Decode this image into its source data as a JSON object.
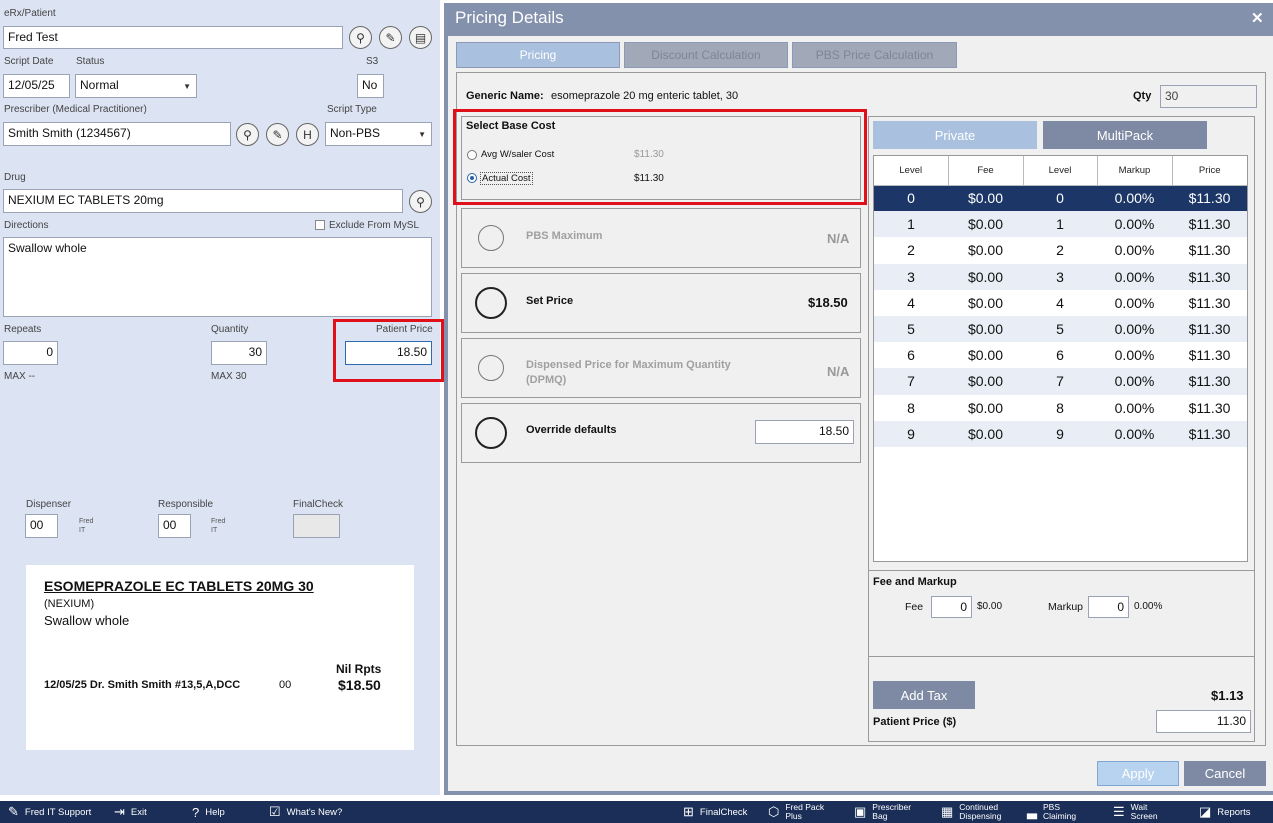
{
  "left": {
    "erx_label": "eRx/Patient",
    "patient_value": "Fred Test",
    "script_date_label": "Script Date",
    "script_date_value": "12/05/25",
    "status_label": "Status",
    "status_value": "Normal",
    "s3_label": "S3",
    "s3_value": "No",
    "prescriber_label": "Prescriber (Medical Practitioner)",
    "prescriber_value": "Smith Smith (1234567)",
    "h_button": "H",
    "script_type_label": "Script Type",
    "script_type_value": "Non-PBS",
    "drug_label": "Drug",
    "drug_value": "NEXIUM EC TABLETS 20mg",
    "directions_label": "Directions",
    "exclude_label": "Exclude From MySL",
    "directions_value": "Swallow whole",
    "repeats_label": "Repeats",
    "repeats_value": "0",
    "repeats_max": "MAX --",
    "quantity_label": "Quantity",
    "quantity_value": "30",
    "quantity_max": "MAX 30",
    "patient_price_label": "Patient Price",
    "patient_price_value": "18.50",
    "dispenser_label": "Dispenser",
    "dispenser_value": "00",
    "dispenser_name": "Fred",
    "dispenser_name2": "IT",
    "responsible_label": "Responsible",
    "responsible_value": "00",
    "responsible_name": "Fred",
    "responsible_name2": "IT",
    "finalcheck_label": "FinalCheck"
  },
  "label_preview": {
    "title": "ESOMEPRAZOLE EC TABLETS 20MG 30",
    "brand": "(NEXIUM)",
    "directions": "Swallow whole",
    "repeats": "Nil Rpts",
    "footer_left": "12/05/25 Dr.  Smith Smith #13,5,A,DCC",
    "footer_code": "00",
    "price": "$18.50"
  },
  "dialog": {
    "title": "Pricing Details",
    "close": "✕",
    "tabs": [
      "Pricing",
      "Discount Calculation",
      "PBS Price Calculation"
    ],
    "generic_label": "Generic Name:",
    "generic_value": "esomeprazole 20 mg enteric tablet, 30",
    "qty_label": "Qty",
    "qty_value": "30",
    "base_cost_title": "Select Base Cost",
    "avg_label": "Avg W/saler Cost",
    "avg_value": "$11.30",
    "actual_label": "Actual Cost",
    "actual_value": "$11.30",
    "options": [
      {
        "label": "PBS Maximum",
        "value": "N/A"
      },
      {
        "label": "Set Price",
        "value": "$18.50"
      },
      {
        "label": "Dispensed Price for Maximum Quantity",
        "label2": "(DPMQ)",
        "value": "N/A"
      },
      {
        "label": "Override defaults",
        "value": "18.50"
      }
    ],
    "private_tab": "Private",
    "multipack_tab": "MultiPack",
    "columns": [
      "Level",
      "Fee",
      "Level",
      "Markup",
      "Price"
    ],
    "rows": [
      [
        "0",
        "$0.00",
        "0",
        "0.00%",
        "$11.30"
      ],
      [
        "1",
        "$0.00",
        "1",
        "0.00%",
        "$11.30"
      ],
      [
        "2",
        "$0.00",
        "2",
        "0.00%",
        "$11.30"
      ],
      [
        "3",
        "$0.00",
        "3",
        "0.00%",
        "$11.30"
      ],
      [
        "4",
        "$0.00",
        "4",
        "0.00%",
        "$11.30"
      ],
      [
        "5",
        "$0.00",
        "5",
        "0.00%",
        "$11.30"
      ],
      [
        "6",
        "$0.00",
        "6",
        "0.00%",
        "$11.30"
      ],
      [
        "7",
        "$0.00",
        "7",
        "0.00%",
        "$11.30"
      ],
      [
        "8",
        "$0.00",
        "8",
        "0.00%",
        "$11.30"
      ],
      [
        "9",
        "$0.00",
        "9",
        "0.00%",
        "$11.30"
      ]
    ],
    "fee_markup_title": "Fee and Markup",
    "fee_label": "Fee",
    "fee_value": "0",
    "fee_display": "$0.00",
    "markup_label": "Markup",
    "markup_value": "0",
    "markup_display": "0.00%",
    "add_tax": "Add Tax",
    "tax_value": "$1.13",
    "patient_price_label": "Patient Price ($)",
    "patient_price_value": "11.30",
    "apply": "Apply",
    "cancel": "Cancel"
  },
  "statusbar": {
    "items": [
      {
        "label": "Fred IT Support"
      },
      {
        "label": "Exit"
      },
      {
        "label": "Help"
      },
      {
        "label": "What's New?"
      },
      {
        "label": "FinalCheck"
      },
      {
        "label": "Fred Pack",
        "label2": "Plus"
      },
      {
        "label": "Prescriber",
        "label2": "Bag"
      },
      {
        "label": "Continued",
        "label2": "Dispensing"
      },
      {
        "label": "PBS",
        "label2": "Claiming"
      },
      {
        "label": "Wait",
        "label2": "Screen"
      },
      {
        "label": "Reports"
      }
    ]
  }
}
